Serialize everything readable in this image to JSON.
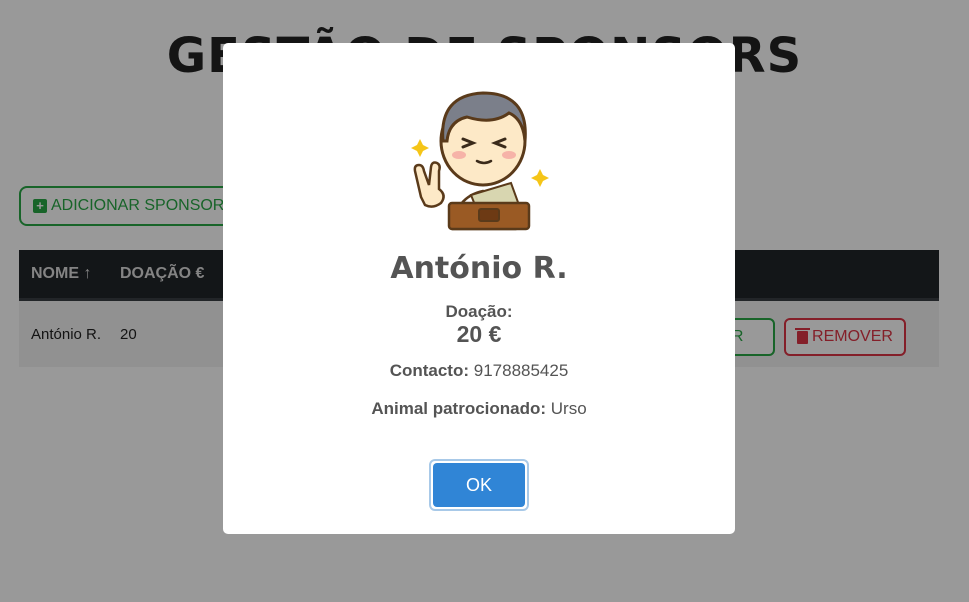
{
  "page": {
    "title": "GESTÃO DE SPONSORS",
    "add_button_label": "ADICIONAR SPONSOR",
    "table": {
      "headers": [
        "NOME",
        "DOAÇÃO €"
      ],
      "sort_icon": "arrow-up-icon",
      "rows": [
        {
          "name": "António R.",
          "donation": "20",
          "view_label": "VER",
          "remove_label": "REMOVER"
        }
      ]
    }
  },
  "modal": {
    "illustration": "person-with-wallet-icon",
    "name": "António R.",
    "donation_label": "Doação:",
    "donation_value": "20 €",
    "contact_label": "Contacto:",
    "contact_value": "9178885425",
    "animal_label": "Animal patrocionado:",
    "animal_value": "Urso",
    "ok_label": "OK"
  },
  "colors": {
    "success": "#28a745",
    "danger": "#dc3545",
    "table_header": "#212529",
    "primary_button": "#3085d6"
  }
}
